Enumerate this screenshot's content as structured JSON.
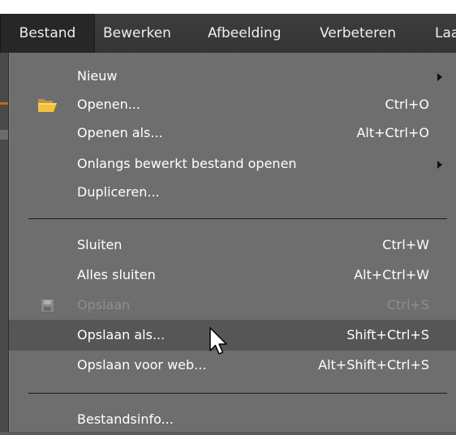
{
  "menubar": {
    "items": [
      {
        "label": "Bestand"
      },
      {
        "label": "Bewerken"
      },
      {
        "label": "Afbeelding"
      },
      {
        "label": "Verbeteren"
      },
      {
        "label": "Laa"
      }
    ]
  },
  "file_menu": {
    "items": [
      {
        "label": "Nieuw",
        "shortcut": ""
      },
      {
        "label": "Openen...",
        "shortcut": "Ctrl+O",
        "icon": "folder-icon"
      },
      {
        "label": "Openen als...",
        "shortcut": "Alt+Ctrl+O"
      },
      {
        "label": "Onlangs bewerkt bestand openen",
        "shortcut": ""
      },
      {
        "label": "Dupliceren...",
        "shortcut": ""
      },
      {
        "label": "Sluiten",
        "shortcut": "Ctrl+W"
      },
      {
        "label": "Alles sluiten",
        "shortcut": "Alt+Ctrl+W"
      },
      {
        "label": "Opslaan",
        "shortcut": "Ctrl+S",
        "icon": "save-icon",
        "disabled": true
      },
      {
        "label": "Opslaan als...",
        "shortcut": "Shift+Ctrl+S",
        "highlighted": true
      },
      {
        "label": "Opslaan voor web...",
        "shortcut": "Alt+Shift+Ctrl+S"
      },
      {
        "label": "Bestandsinfo...",
        "shortcut": ""
      }
    ]
  },
  "colors": {
    "menubar_bg": "#3a3a3a",
    "menu_bg": "#6e6e6e",
    "highlight_bg": "#565656",
    "disabled_text": "#8f8f8f",
    "folder_icon": "#f3c23f"
  },
  "cursor": "arrow-pointer"
}
